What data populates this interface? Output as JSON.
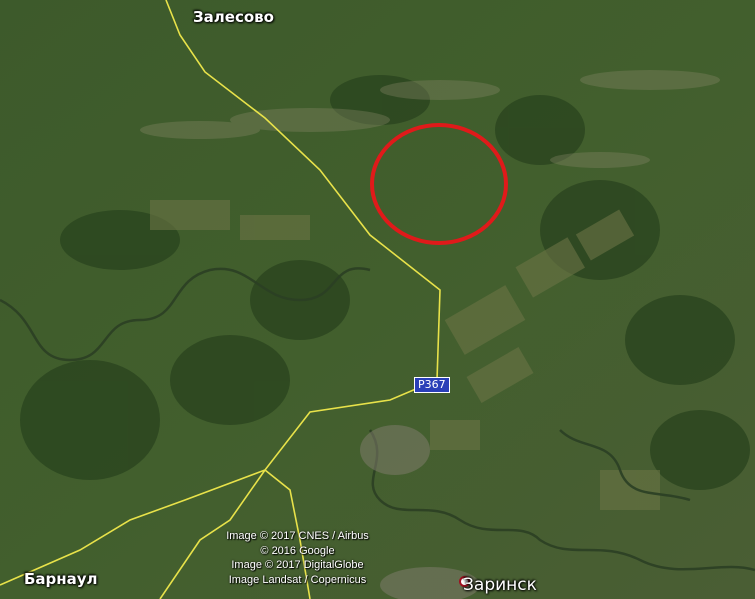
{
  "map": {
    "places": {
      "zalesovo": "Залесово",
      "barnaul": "Барнаул",
      "zarinsk": "Заринск"
    },
    "road_shield": "Р367",
    "credits": [
      "Image © 2017 CNES / Airbus",
      "© 2016 Google",
      "Image © 2017 DigitalGlobe",
      "Image Landsat / Copernicus"
    ],
    "colors": {
      "road": "#e8e24a",
      "highlight_circle": "#e01a1a",
      "shield": "#2a3fb8"
    }
  }
}
